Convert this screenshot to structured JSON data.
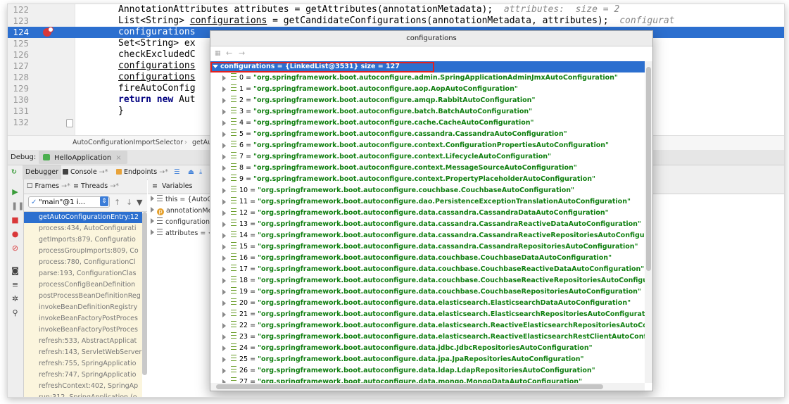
{
  "editor": {
    "lines": [
      {
        "num": "122",
        "pre": "AnnotationAttributes attributes = getAttributes(annotationMetadata);  ",
        "comment": "attributes:  size = 2"
      },
      {
        "num": "123",
        "pre": "List<String> ",
        "ul": "configurations",
        "post": " = getCandidateConfigurations(annotationMetadata, attributes);  ",
        "comment": "configurat"
      },
      {
        "num": "124",
        "pre": "configurations"
      },
      {
        "num": "125",
        "pre": "Set<String> ex"
      },
      {
        "num": "126",
        "pre": "checkExcludedC"
      },
      {
        "num": "127",
        "ul": "configurations"
      },
      {
        "num": "128",
        "ul": "configurations"
      },
      {
        "num": "129",
        "pre": "fireAutoConfig"
      },
      {
        "num": "130",
        "kw": "return new",
        "post": " Aut"
      },
      {
        "num": "131",
        "pre": "}"
      },
      {
        "num": "132",
        "pre": ""
      }
    ]
  },
  "breadcrumb": {
    "class_name": "AutoConfigurationImportSelector",
    "sep": "›",
    "method": "getAutoC"
  },
  "debug": {
    "label": "Debug:",
    "app_tab": "HelloApplication",
    "close": "×",
    "tabs": {
      "debugger": "Debugger",
      "console": "Console",
      "endpoints": "Endpoints",
      "arrow": "→*"
    },
    "frames_header": "Frames",
    "threads_header": "Threads",
    "thread": "\"main\"@1 i...",
    "frames": [
      "getAutoConfigurationEntry:12",
      "process:434, AutoConfigurati",
      "getImports:879, Configuratio",
      "processGroupImports:809, Co",
      "process:780, ConfigurationCl",
      "parse:193, ConfigurationClas",
      "processConfigBeanDefinition",
      "postProcessBeanDefinitionReg",
      "invokeBeanDefinitionRegistry",
      "invokeBeanFactoryPostProces",
      "invokeBeanFactoryPostProces",
      "refresh:533, AbstractApplicat",
      "refresh:143, ServletWebServer",
      "refresh:755, SpringApplicatio",
      "refresh:747, SpringApplicatio",
      "refreshContext:402, SpringAp",
      "run:312, SpringApplication (o"
    ],
    "variables_header": "Variables",
    "variables": [
      "this = {AutoC",
      "annotationMe",
      "configuration",
      "attributes = {"
    ]
  },
  "popup": {
    "title": "configurations",
    "back": "←",
    "forward": "→",
    "root": "configurations = {LinkedList@3531}  size = 127",
    "items": [
      "\"org.springframework.boot.autoconfigure.admin.SpringApplicationAdminJmxAutoConfiguration\"",
      "\"org.springframework.boot.autoconfigure.aop.AopAutoConfiguration\"",
      "\"org.springframework.boot.autoconfigure.amqp.RabbitAutoConfiguration\"",
      "\"org.springframework.boot.autoconfigure.batch.BatchAutoConfiguration\"",
      "\"org.springframework.boot.autoconfigure.cache.CacheAutoConfiguration\"",
      "\"org.springframework.boot.autoconfigure.cassandra.CassandraAutoConfiguration\"",
      "\"org.springframework.boot.autoconfigure.context.ConfigurationPropertiesAutoConfiguration\"",
      "\"org.springframework.boot.autoconfigure.context.LifecycleAutoConfiguration\"",
      "\"org.springframework.boot.autoconfigure.context.MessageSourceAutoConfiguration\"",
      "\"org.springframework.boot.autoconfigure.context.PropertyPlaceholderAutoConfiguration\"",
      "\"org.springframework.boot.autoconfigure.couchbase.CouchbaseAutoConfiguration\"",
      "\"org.springframework.boot.autoconfigure.dao.PersistenceExceptionTranslationAutoConfiguration\"",
      "\"org.springframework.boot.autoconfigure.data.cassandra.CassandraDataAutoConfiguration\"",
      "\"org.springframework.boot.autoconfigure.data.cassandra.CassandraReactiveDataAutoConfiguration\"",
      "\"org.springframework.boot.autoconfigure.data.cassandra.CassandraReactiveRepositoriesAutoConfigura",
      "\"org.springframework.boot.autoconfigure.data.cassandra.CassandraRepositoriesAutoConfiguration\"",
      "\"org.springframework.boot.autoconfigure.data.couchbase.CouchbaseDataAutoConfiguration\"",
      "\"org.springframework.boot.autoconfigure.data.couchbase.CouchbaseReactiveDataAutoConfiguration\"",
      "\"org.springframework.boot.autoconfigure.data.couchbase.CouchbaseReactiveRepositoriesAutoConfigura",
      "\"org.springframework.boot.autoconfigure.data.couchbase.CouchbaseRepositoriesAutoConfiguration\"",
      "\"org.springframework.boot.autoconfigure.data.elasticsearch.ElasticsearchDataAutoConfiguration\"",
      "\"org.springframework.boot.autoconfigure.data.elasticsearch.ElasticsearchRepositoriesAutoConfiguratior",
      "\"org.springframework.boot.autoconfigure.data.elasticsearch.ReactiveElasticsearchRepositoriesAutoConf",
      "\"org.springframework.boot.autoconfigure.data.elasticsearch.ReactiveElasticsearchRestClientAutoConfigu",
      "\"org.springframework.boot.autoconfigure.data.jdbc.JdbcRepositoriesAutoConfiguration\"",
      "\"org.springframework.boot.autoconfigure.data.jpa.JpaRepositoriesAutoConfiguration\"",
      "\"org.springframework.boot.autoconfigure.data.ldap.LdapRepositoriesAutoConfiguration\"",
      "\"org.springframework.boot.autoconfigure.data.mongo.MongoDataAutoConfiguration\""
    ]
  }
}
